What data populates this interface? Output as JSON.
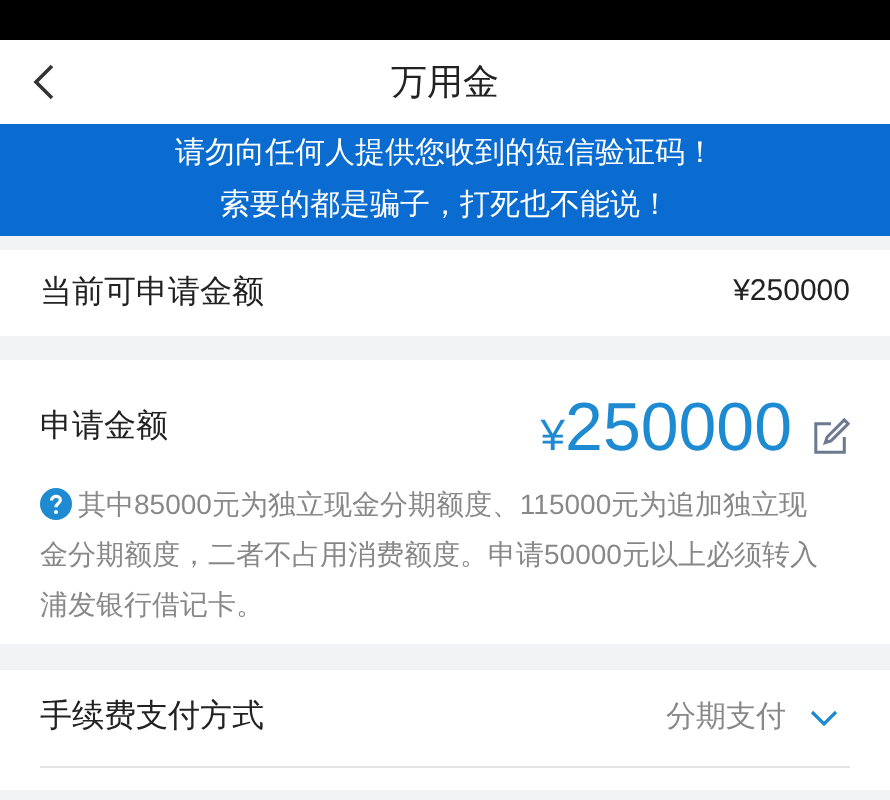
{
  "nav": {
    "title": "万用金"
  },
  "banner": {
    "lines": [
      "请勿向任何人提供您收到的短信验证码！",
      "索要的都是骗子，打死也不能说！"
    ]
  },
  "available": {
    "label": "当前可申请金额",
    "value": "¥250000"
  },
  "apply": {
    "label": "申请金额",
    "currency": "¥",
    "amount": "250000",
    "note": "其中85000元为独立现金分期额度、115000元为追加独立现金分期额度，二者不占用消费额度。申请50000元以上必须转入浦发银行借记卡。"
  },
  "options": [
    {
      "label": "手续费支付方式",
      "value": "分期支付"
    }
  ]
}
